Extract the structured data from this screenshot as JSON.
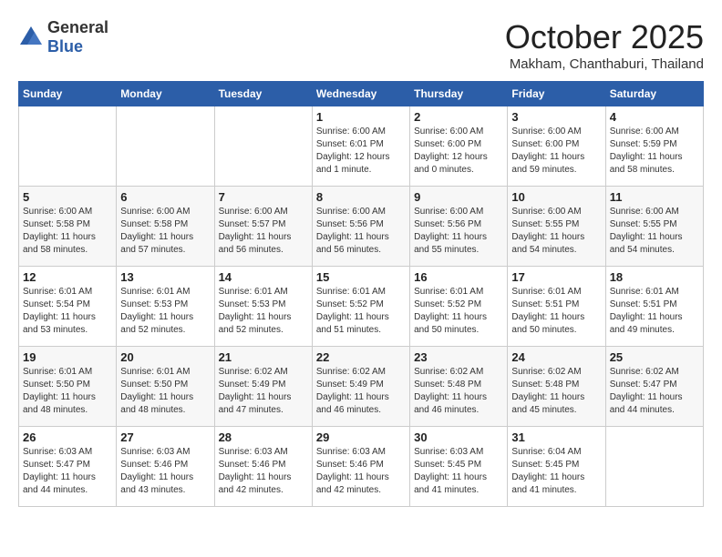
{
  "header": {
    "logo_general": "General",
    "logo_blue": "Blue",
    "month": "October 2025",
    "location": "Makham, Chanthaburi, Thailand"
  },
  "weekdays": [
    "Sunday",
    "Monday",
    "Tuesday",
    "Wednesday",
    "Thursday",
    "Friday",
    "Saturday"
  ],
  "weeks": [
    [
      {
        "day": "",
        "info": ""
      },
      {
        "day": "",
        "info": ""
      },
      {
        "day": "",
        "info": ""
      },
      {
        "day": "1",
        "info": "Sunrise: 6:00 AM\nSunset: 6:01 PM\nDaylight: 12 hours\nand 1 minute."
      },
      {
        "day": "2",
        "info": "Sunrise: 6:00 AM\nSunset: 6:00 PM\nDaylight: 12 hours\nand 0 minutes."
      },
      {
        "day": "3",
        "info": "Sunrise: 6:00 AM\nSunset: 6:00 PM\nDaylight: 11 hours\nand 59 minutes."
      },
      {
        "day": "4",
        "info": "Sunrise: 6:00 AM\nSunset: 5:59 PM\nDaylight: 11 hours\nand 58 minutes."
      }
    ],
    [
      {
        "day": "5",
        "info": "Sunrise: 6:00 AM\nSunset: 5:58 PM\nDaylight: 11 hours\nand 58 minutes."
      },
      {
        "day": "6",
        "info": "Sunrise: 6:00 AM\nSunset: 5:58 PM\nDaylight: 11 hours\nand 57 minutes."
      },
      {
        "day": "7",
        "info": "Sunrise: 6:00 AM\nSunset: 5:57 PM\nDaylight: 11 hours\nand 56 minutes."
      },
      {
        "day": "8",
        "info": "Sunrise: 6:00 AM\nSunset: 5:56 PM\nDaylight: 11 hours\nand 56 minutes."
      },
      {
        "day": "9",
        "info": "Sunrise: 6:00 AM\nSunset: 5:56 PM\nDaylight: 11 hours\nand 55 minutes."
      },
      {
        "day": "10",
        "info": "Sunrise: 6:00 AM\nSunset: 5:55 PM\nDaylight: 11 hours\nand 54 minutes."
      },
      {
        "day": "11",
        "info": "Sunrise: 6:00 AM\nSunset: 5:55 PM\nDaylight: 11 hours\nand 54 minutes."
      }
    ],
    [
      {
        "day": "12",
        "info": "Sunrise: 6:01 AM\nSunset: 5:54 PM\nDaylight: 11 hours\nand 53 minutes."
      },
      {
        "day": "13",
        "info": "Sunrise: 6:01 AM\nSunset: 5:53 PM\nDaylight: 11 hours\nand 52 minutes."
      },
      {
        "day": "14",
        "info": "Sunrise: 6:01 AM\nSunset: 5:53 PM\nDaylight: 11 hours\nand 52 minutes."
      },
      {
        "day": "15",
        "info": "Sunrise: 6:01 AM\nSunset: 5:52 PM\nDaylight: 11 hours\nand 51 minutes."
      },
      {
        "day": "16",
        "info": "Sunrise: 6:01 AM\nSunset: 5:52 PM\nDaylight: 11 hours\nand 50 minutes."
      },
      {
        "day": "17",
        "info": "Sunrise: 6:01 AM\nSunset: 5:51 PM\nDaylight: 11 hours\nand 50 minutes."
      },
      {
        "day": "18",
        "info": "Sunrise: 6:01 AM\nSunset: 5:51 PM\nDaylight: 11 hours\nand 49 minutes."
      }
    ],
    [
      {
        "day": "19",
        "info": "Sunrise: 6:01 AM\nSunset: 5:50 PM\nDaylight: 11 hours\nand 48 minutes."
      },
      {
        "day": "20",
        "info": "Sunrise: 6:01 AM\nSunset: 5:50 PM\nDaylight: 11 hours\nand 48 minutes."
      },
      {
        "day": "21",
        "info": "Sunrise: 6:02 AM\nSunset: 5:49 PM\nDaylight: 11 hours\nand 47 minutes."
      },
      {
        "day": "22",
        "info": "Sunrise: 6:02 AM\nSunset: 5:49 PM\nDaylight: 11 hours\nand 46 minutes."
      },
      {
        "day": "23",
        "info": "Sunrise: 6:02 AM\nSunset: 5:48 PM\nDaylight: 11 hours\nand 46 minutes."
      },
      {
        "day": "24",
        "info": "Sunrise: 6:02 AM\nSunset: 5:48 PM\nDaylight: 11 hours\nand 45 minutes."
      },
      {
        "day": "25",
        "info": "Sunrise: 6:02 AM\nSunset: 5:47 PM\nDaylight: 11 hours\nand 44 minutes."
      }
    ],
    [
      {
        "day": "26",
        "info": "Sunrise: 6:03 AM\nSunset: 5:47 PM\nDaylight: 11 hours\nand 44 minutes."
      },
      {
        "day": "27",
        "info": "Sunrise: 6:03 AM\nSunset: 5:46 PM\nDaylight: 11 hours\nand 43 minutes."
      },
      {
        "day": "28",
        "info": "Sunrise: 6:03 AM\nSunset: 5:46 PM\nDaylight: 11 hours\nand 42 minutes."
      },
      {
        "day": "29",
        "info": "Sunrise: 6:03 AM\nSunset: 5:46 PM\nDaylight: 11 hours\nand 42 minutes."
      },
      {
        "day": "30",
        "info": "Sunrise: 6:03 AM\nSunset: 5:45 PM\nDaylight: 11 hours\nand 41 minutes."
      },
      {
        "day": "31",
        "info": "Sunrise: 6:04 AM\nSunset: 5:45 PM\nDaylight: 11 hours\nand 41 minutes."
      },
      {
        "day": "",
        "info": ""
      }
    ]
  ]
}
